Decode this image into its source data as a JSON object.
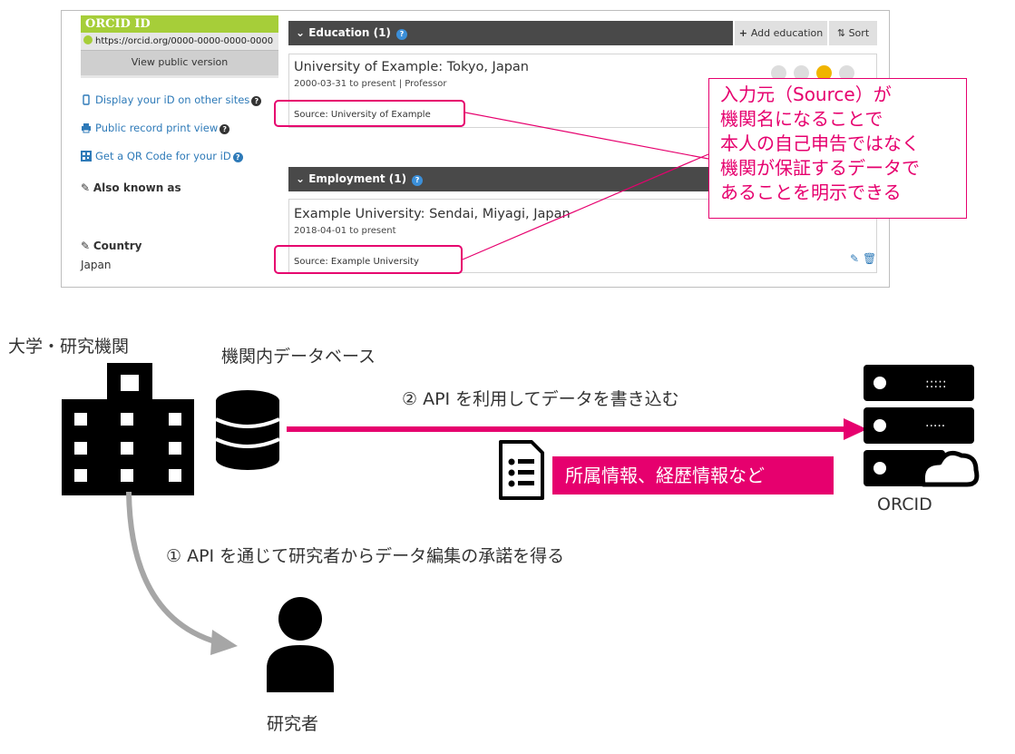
{
  "orcid_panel": {
    "id_header": "ORCID ID",
    "id_url": "https://orcid.org/0000-0000-0000-0000",
    "view_public": "View public version",
    "sidebar": {
      "display_id": "Display your iD on other sites",
      "print_view": "Public record print view",
      "qr_code": "Get a QR Code for your iD",
      "also_known_as": "Also known as",
      "country_label": "Country",
      "country_value": "Japan"
    },
    "education": {
      "header": "Education (1)",
      "add_label": "Add education",
      "sort_label": "Sort",
      "title": "University of Example: Tokyo, Japan",
      "dates": "2000-03-31 to present | Professor",
      "source": "Source: University of Example"
    },
    "employment": {
      "header": "Employment (1)",
      "title": "Example University: Sendai, Miyagi, Japan",
      "dates": "2018-04-01 to present",
      "source": "Source: Example University"
    }
  },
  "callout": {
    "lines": [
      "入力元（Source）が",
      "機関名になることで",
      "本人の自己申告ではなく",
      "機関が保証するデータで",
      "あることを明示できる"
    ]
  },
  "diagram": {
    "institution_label": "大学・研究機関",
    "database_label": "機関内データベース",
    "step2_label": "② API を利用してデータを書き込む",
    "data_badge": "所属情報、経歴情報など",
    "orcid_label": "ORCID",
    "step1_label": "① API を通じて研究者からデータ編集の承諾を得る",
    "researcher_label": "研究者"
  },
  "colors": {
    "accent": "#e6006e",
    "orcid_green": "#a6ce39",
    "section_bar": "#494949",
    "arrow_gray": "#a6a6a6"
  }
}
